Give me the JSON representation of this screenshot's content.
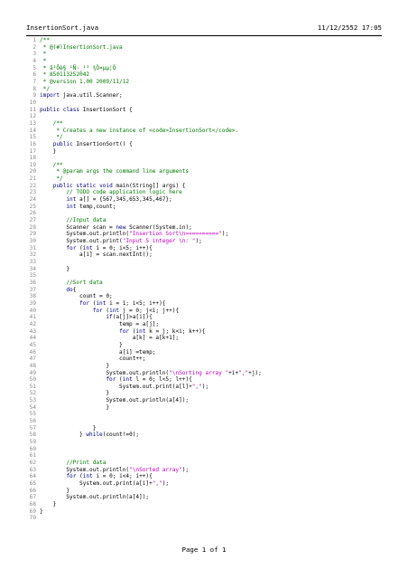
{
  "header": {
    "filename": "InsertionSort.java",
    "datetime": "11/12/2552 17:05"
  },
  "footer": {
    "page_label": "Page 1 of 1"
  },
  "colors": {
    "keyword": "#000080",
    "comment": "#007a00",
    "string": "#c000c0",
    "number": "#0000c0",
    "annotation": "#808000"
  },
  "lines": [
    {
      "n": "1",
      "t": "/**",
      "s": "cm"
    },
    {
      "n": "2",
      "t": " * @(#)InsertionSort.java",
      "s": "cm"
    },
    {
      "n": "3",
      "t": " *",
      "s": "cm"
    },
    {
      "n": "4",
      "t": " *",
      "s": "cm"
    },
    {
      "n": "5",
      "t": " * ã²Ôè§ ¹Ñ·¸¹³ ¾Ö¤µµ¦Ö",
      "s": "cm"
    },
    {
      "n": "6",
      "t": " * 850113252042",
      "s": "cm"
    },
    {
      "n": "7",
      "t": " * @version 1.00 2009/11/12",
      "s": "cm"
    },
    {
      "n": "8",
      "t": " */",
      "s": "cm"
    },
    {
      "n": "9",
      "t": "import java.util.Scanner;",
      "s": "kw"
    },
    {
      "n": "10",
      "t": "",
      "s": ""
    },
    {
      "n": "11",
      "t": "public class InsertionSort {",
      "s": "kw"
    },
    {
      "n": "12",
      "t": "",
      "s": ""
    },
    {
      "n": "13",
      "t": "    /**",
      "s": "cm"
    },
    {
      "n": "14",
      "t": "     * Creates a new instance of <code>InsertionSort</code>.",
      "s": "cm"
    },
    {
      "n": "15",
      "t": "     */",
      "s": "cm"
    },
    {
      "n": "16",
      "t": "    public InsertionSort() {",
      "s": "kw"
    },
    {
      "n": "17",
      "t": "    }",
      "s": ""
    },
    {
      "n": "18",
      "t": "",
      "s": ""
    },
    {
      "n": "19",
      "t": "    /**",
      "s": "cm"
    },
    {
      "n": "20",
      "t": "     * @param args the command line arguments",
      "s": "cm"
    },
    {
      "n": "21",
      "t": "     */",
      "s": "cm"
    },
    {
      "n": "22",
      "t": "    public static void main(String[] args) {",
      "s": "kw"
    },
    {
      "n": "23",
      "t": "        // TODO code application logic here",
      "s": "cm"
    },
    {
      "n": "24",
      "t": "        int a[] = {567,345,653,345,467};",
      "s": "kw"
    },
    {
      "n": "25",
      "t": "        int temp,count;",
      "s": "kw"
    },
    {
      "n": "26",
      "t": "",
      "s": ""
    },
    {
      "n": "27",
      "t": "        //Input data",
      "s": "cm"
    },
    {
      "n": "28",
      "t": "        Scanner scan = new Scanner(System.in);",
      "s": ""
    },
    {
      "n": "29",
      "t": "        System.out.println(\"Insertion Sort\\n==========\");",
      "s": "st"
    },
    {
      "n": "30",
      "t": "        System.out.print(\"Input 5 integer \\n: \");",
      "s": "st"
    },
    {
      "n": "31",
      "t": "        for (int i = 0; i<5; i++){",
      "s": "kw"
    },
    {
      "n": "32",
      "t": "            a[i] = scan.nextInt();",
      "s": ""
    },
    {
      "n": "33",
      "t": "",
      "s": ""
    },
    {
      "n": "34",
      "t": "        }",
      "s": ""
    },
    {
      "n": "35",
      "t": "",
      "s": ""
    },
    {
      "n": "36",
      "t": "        //Sort data",
      "s": "cm"
    },
    {
      "n": "37",
      "t": "        do{",
      "s": "kw"
    },
    {
      "n": "38",
      "t": "            count = 0;",
      "s": ""
    },
    {
      "n": "39",
      "t": "            for (int i = 1; i<5; i++){",
      "s": "kw"
    },
    {
      "n": "40",
      "t": "                for (int j = 0; j<i; j++){",
      "s": "kw"
    },
    {
      "n": "41",
      "t": "                    if(a[j]>a[i]){",
      "s": "kw"
    },
    {
      "n": "42",
      "t": "                        temp = a[j];",
      "s": ""
    },
    {
      "n": "43",
      "t": "                        for (int k = j; k<i; k++){",
      "s": "kw"
    },
    {
      "n": "44",
      "t": "                            a[k] = a[k+1];",
      "s": ""
    },
    {
      "n": "45",
      "t": "                        }",
      "s": ""
    },
    {
      "n": "46",
      "t": "                        a[i] =temp;",
      "s": ""
    },
    {
      "n": "47",
      "t": "                        count++;",
      "s": ""
    },
    {
      "n": "48",
      "t": "                    }",
      "s": ""
    },
    {
      "n": "49",
      "t": "                    System.out.println(\"\\nSorting array \"+i+\",\"+j);",
      "s": "st"
    },
    {
      "n": "50",
      "t": "                    for (int l = 0; l<5; l++){",
      "s": "kw"
    },
    {
      "n": "51",
      "t": "                        System.out.print(a[l]+\",\");",
      "s": "st"
    },
    {
      "n": "52",
      "t": "                    }",
      "s": ""
    },
    {
      "n": "53",
      "t": "                    System.out.println(a[4]);",
      "s": ""
    },
    {
      "n": "54",
      "t": "                    }",
      "s": ""
    },
    {
      "n": "55",
      "t": "",
      "s": ""
    },
    {
      "n": "56",
      "t": "",
      "s": ""
    },
    {
      "n": "57",
      "t": "                }",
      "s": ""
    },
    {
      "n": "58",
      "t": "            } while(count!=0);",
      "s": "kw"
    },
    {
      "n": "59",
      "t": "",
      "s": ""
    },
    {
      "n": "60",
      "t": "",
      "s": ""
    },
    {
      "n": "61",
      "t": "",
      "s": ""
    },
    {
      "n": "62",
      "t": "        //Print data",
      "s": "cm"
    },
    {
      "n": "63",
      "t": "        System.out.println(\"\\nSorted array\");",
      "s": "st"
    },
    {
      "n": "64",
      "t": "        for (int i = 0; i<4; i++){",
      "s": "kw"
    },
    {
      "n": "65",
      "t": "            System.out.print(a[i]+\",\");",
      "s": "st"
    },
    {
      "n": "66",
      "t": "        }",
      "s": ""
    },
    {
      "n": "67",
      "t": "        System.out.println(a[4]);",
      "s": ""
    },
    {
      "n": "68",
      "t": "    }",
      "s": ""
    },
    {
      "n": "69",
      "t": "}",
      "s": ""
    },
    {
      "n": "70",
      "t": "",
      "s": ""
    }
  ]
}
